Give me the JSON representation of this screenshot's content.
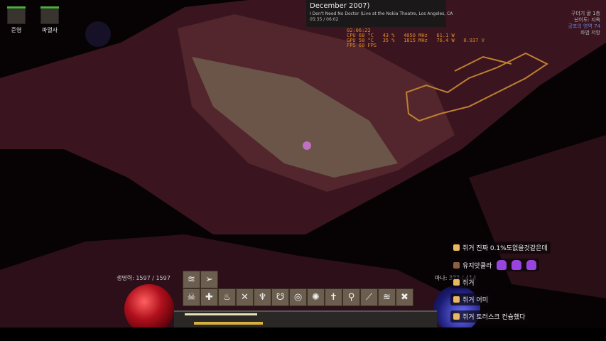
{
  "mercenaries": [
    {
      "name": "준영"
    },
    {
      "name": "파멸사"
    }
  ],
  "music": {
    "title": "December 2007)",
    "subtitle": "I Don't Need No Doctor (Live at the Nokia Theatre, Los Angeles, CA",
    "time": "05:35 / 06:02"
  },
  "hw_monitor": {
    "clock": "02:06:22",
    "cpu": "CPU 68 °C   43 %   4050 MHz   61.1 W",
    "gpu": "GPU 58 °C   35 %   1815 MHz   76.4 W   0.937 V",
    "fps": "FPS 60 FPS"
  },
  "area_info": [
    "구더기 굴 1층",
    "난이도: 지옥",
    "공포의 영역 74",
    "화염 저항"
  ],
  "hud": {
    "life": "생명력: 1597 / 1597",
    "mana": "마나: 372 / 414",
    "colors": {
      "life": "#b0101c",
      "mana": "#1a1a70"
    }
  },
  "skills_top": [
    "≋",
    "➢"
  ],
  "skills": [
    "☠",
    "✚",
    "♨",
    "✕",
    "♆",
    "☋",
    "◎",
    "✺",
    "✝",
    "⚲",
    "⟋",
    "≋",
    "✖"
  ],
  "chat": [
    {
      "icon": "badge",
      "text": "쥐거 진짜 0.1%도없을것같은데"
    },
    {
      "icon": "poop",
      "text": "유지맛쿨라",
      "emotes": 3
    },
    {
      "icon": "badge",
      "text": "쥐거"
    },
    {
      "icon": "badge",
      "text": "쥐거 어미"
    },
    {
      "icon": "badge",
      "text": "쥐거 토러스크 컨슘했다"
    }
  ]
}
